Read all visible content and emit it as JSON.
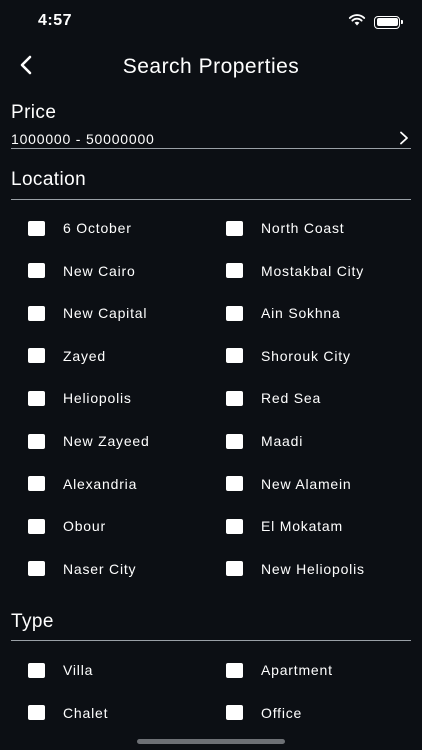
{
  "status_bar": {
    "time": "4:57",
    "icons": [
      "wifi-icon",
      "battery-icon"
    ]
  },
  "nav": {
    "back_icon": "chevron-left-icon",
    "title": "Search Properties"
  },
  "price": {
    "title": "Price",
    "range": "1000000 - 50000000",
    "chevron_icon": "chevron-right-icon"
  },
  "location": {
    "title": "Location",
    "options": [
      "6 October",
      "North Coast",
      "New Cairo",
      "Mostakbal City",
      "New Capital",
      "Ain Sokhna",
      "Zayed",
      "Shorouk City",
      "Heliopolis",
      "Red Sea",
      "New Zayeed",
      "Maadi",
      "Alexandria",
      "New Alamein",
      "Obour",
      "El Mokatam",
      "Naser City",
      "New Heliopolis"
    ]
  },
  "type": {
    "title": "Type",
    "options": [
      "Villa",
      "Apartment",
      "Chalet",
      "Office"
    ]
  },
  "colors": {
    "background": "#0c0f14",
    "text": "#ffffff",
    "divider": "#9aa0a6",
    "checkbox": "#ffffff"
  }
}
